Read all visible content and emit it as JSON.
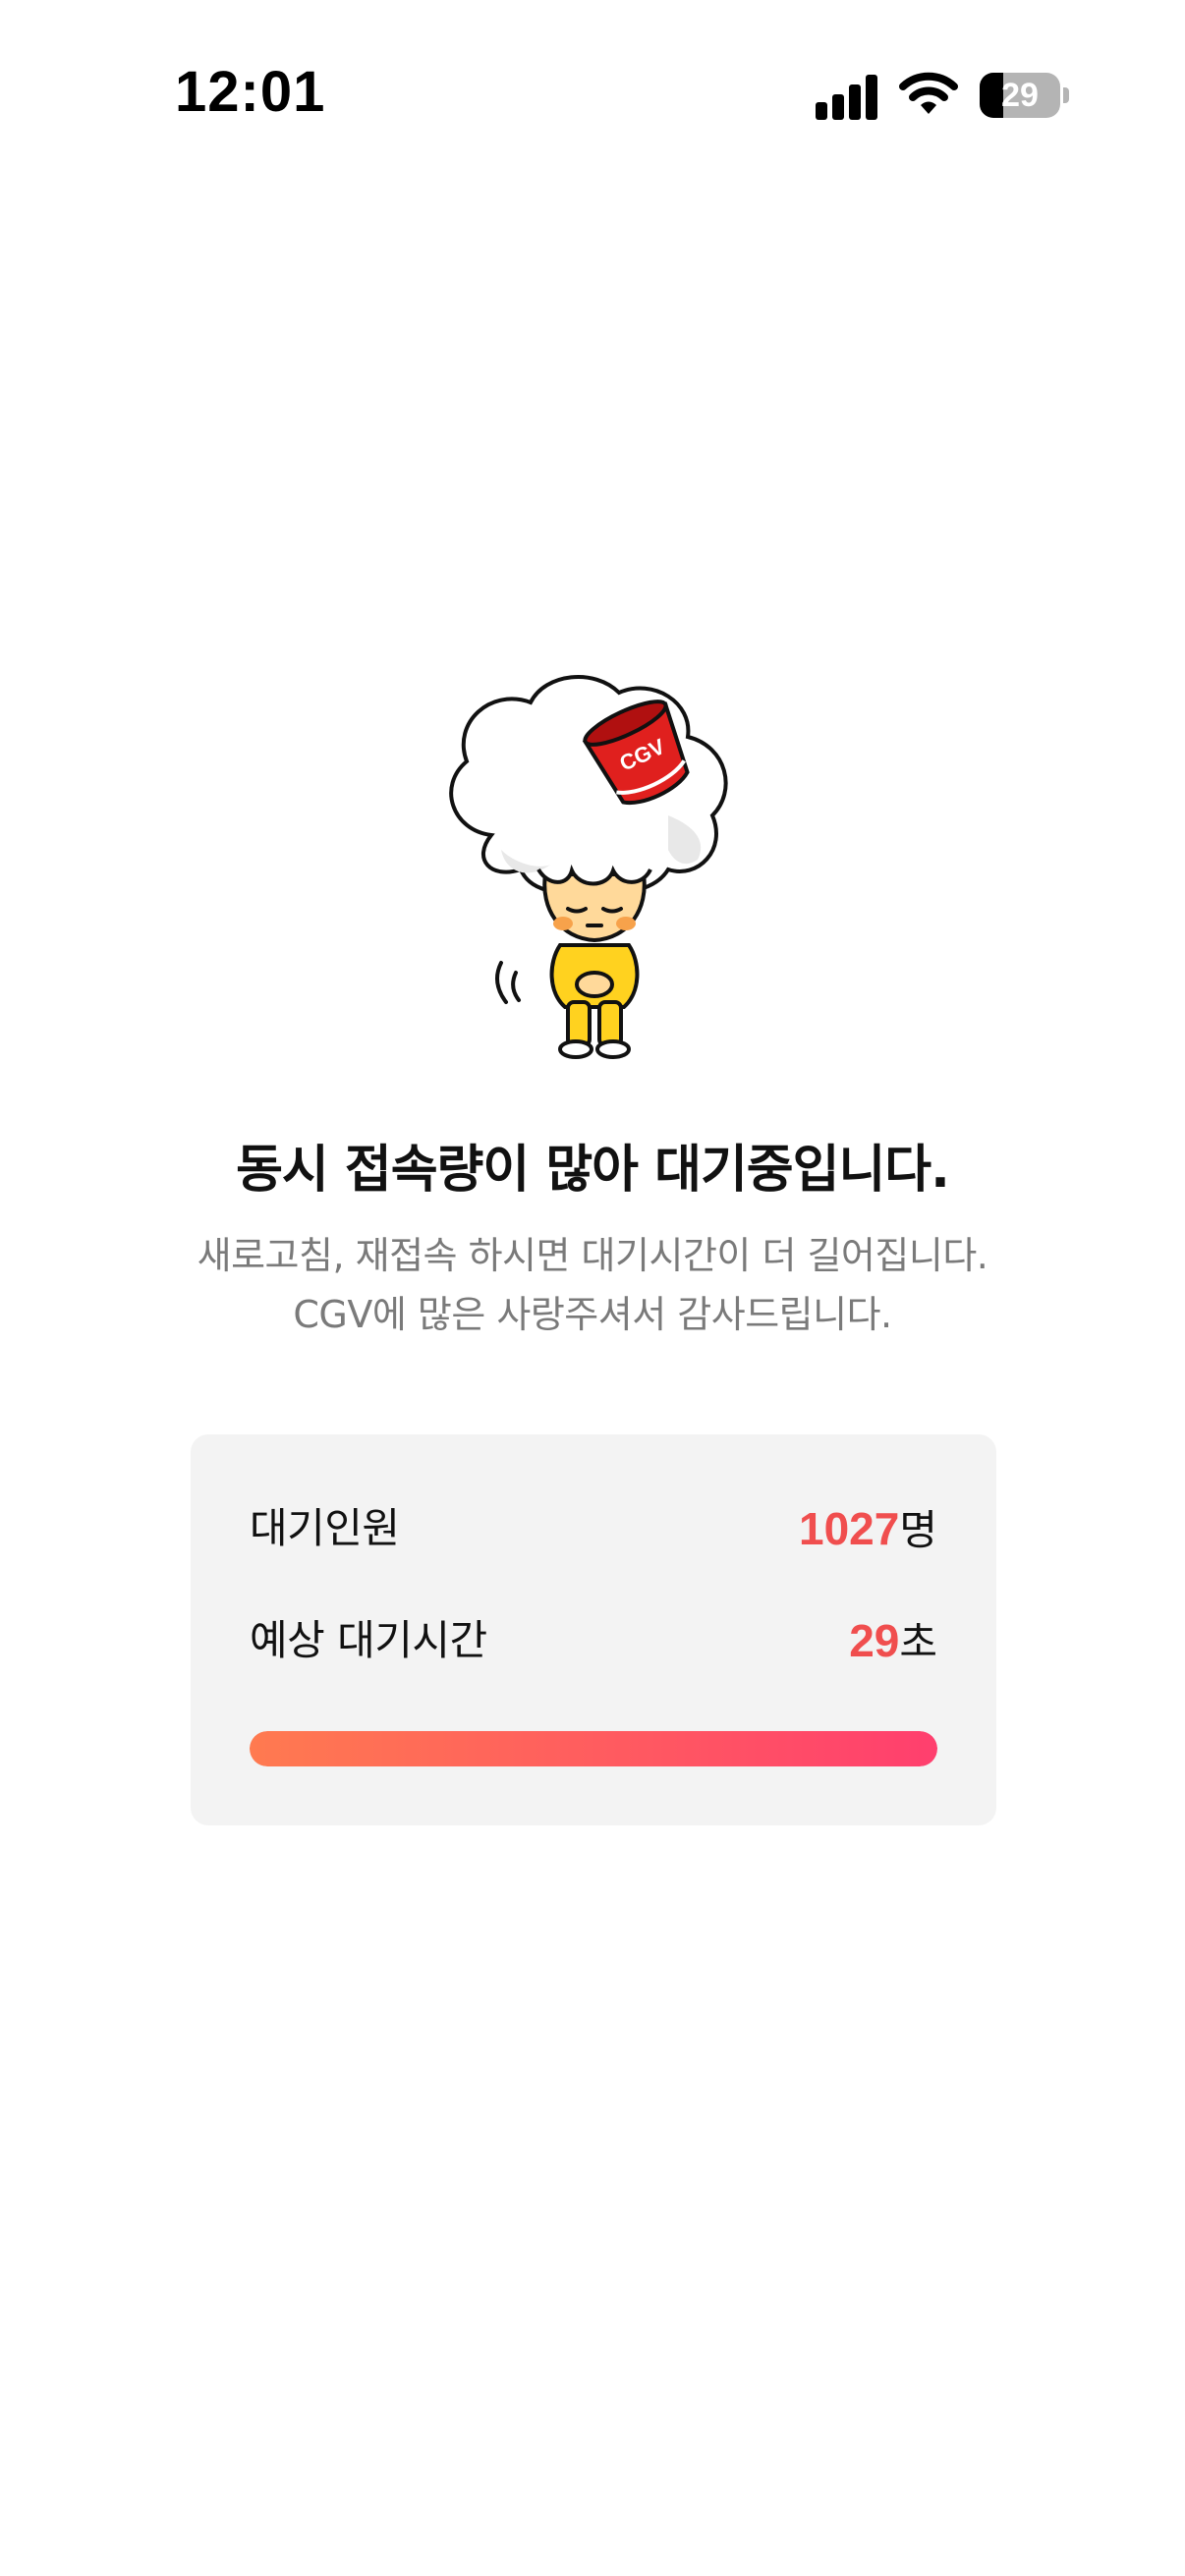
{
  "status_bar": {
    "time": "12:01",
    "battery_level": "29",
    "icons": [
      "signal-icon",
      "wifi-icon",
      "battery-icon"
    ]
  },
  "mascot": {
    "icon": "cgv-mascot-illustration",
    "bucket_logo": "CGV"
  },
  "headline": "동시 접속량이 많아 대기중입니다.",
  "message": {
    "line1": "새로고침, 재접속 하시면 대기시간이 더 길어집니다.",
    "line2": "CGV에 많은 사랑주셔서 감사드립니다."
  },
  "queue": {
    "waiting_label": "대기인원",
    "waiting_count": "1027",
    "waiting_unit": "명",
    "time_label": "예상 대기시간",
    "time_value": "29",
    "time_unit": "초",
    "progress": 1.0
  },
  "colors": {
    "accent": "#f04e4e",
    "progress_start": "#ff7a50",
    "progress_end": "#ff3f6e",
    "card_bg": "#f3f3f3",
    "mascot_outfit": "#ffd21f",
    "bucket_red": "#e0201e"
  }
}
